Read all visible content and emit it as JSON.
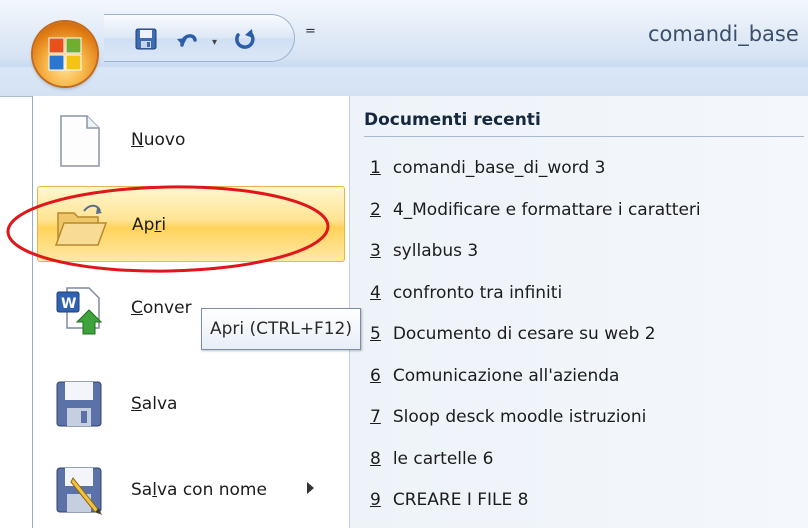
{
  "window": {
    "title": "comandi_base",
    "qat_dropdown_glyph": "▾",
    "qat_customize_glyph": "="
  },
  "menu": {
    "items": [
      {
        "label_pre": "",
        "label_key": "N",
        "label_post": "uovo",
        "icon": "new-document-icon"
      },
      {
        "label_pre": "Ap",
        "label_key": "r",
        "label_post": "i",
        "icon": "open-folder-icon"
      },
      {
        "label_pre": "",
        "label_key": "C",
        "label_post": "onver",
        "icon": "convert-icon"
      },
      {
        "label_pre": "",
        "label_key": "S",
        "label_post": "alva",
        "icon": "save-icon"
      },
      {
        "label_pre": "Sa",
        "label_key": "l",
        "label_post": "va con nome",
        "icon": "save-as-icon"
      }
    ]
  },
  "recent": {
    "header": "Documenti recenti",
    "items": [
      {
        "num": "1",
        "name": "comandi_base_di_word 3"
      },
      {
        "num": "2",
        "name": "4_Modificare e formattare i caratteri"
      },
      {
        "num": "3",
        "name": "syllabus 3"
      },
      {
        "num": "4",
        "name": "confronto tra infiniti"
      },
      {
        "num": "5",
        "name": "Documento di cesare su web 2"
      },
      {
        "num": "6",
        "name": "Comunicazione all'azienda"
      },
      {
        "num": "7",
        "name": "Sloop desck moodle istruzioni"
      },
      {
        "num": "8",
        "name": "le cartelle 6"
      },
      {
        "num": "9",
        "name": "CREARE I FILE 8"
      }
    ]
  },
  "tooltip": {
    "text": "Apri (CTRL+F12)"
  },
  "colors": {
    "annotation": "#e0161b",
    "highlight": "#ffd25a",
    "office_orange": "#e07a12"
  }
}
